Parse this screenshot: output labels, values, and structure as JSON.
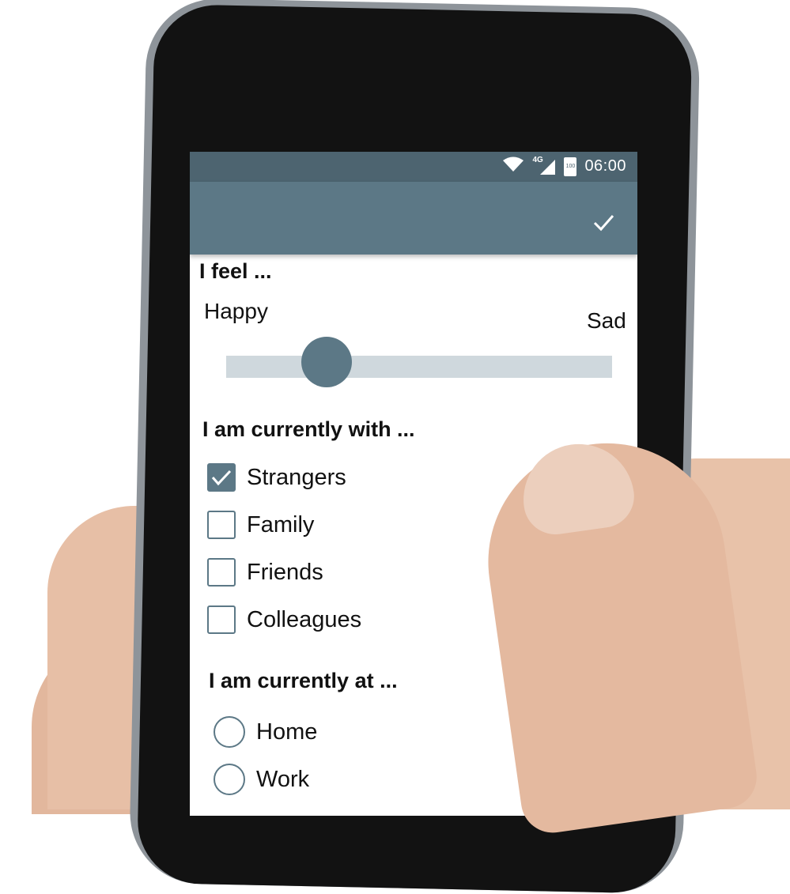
{
  "status": {
    "network": "4G",
    "battery": "100",
    "time": "06:00"
  },
  "appbar": {
    "confirm_icon": "check-icon"
  },
  "feel": {
    "question": "I feel ...",
    "min_label": "Happy",
    "max_label": "Sad",
    "value": 0.26
  },
  "with": {
    "question": "I am currently with ...",
    "options": [
      {
        "label": "Strangers",
        "checked": true
      },
      {
        "label": "Family",
        "checked": false
      },
      {
        "label": "Friends",
        "checked": false
      },
      {
        "label": "Colleagues",
        "checked": false
      }
    ]
  },
  "at": {
    "question": "I am currently at ...",
    "options": [
      {
        "label": "Home",
        "selected": false
      },
      {
        "label": "Work",
        "selected": false
      }
    ]
  },
  "colors": {
    "accent": "#5c7886",
    "statusbar": "#4d6470",
    "track": "#cfd8dd"
  }
}
